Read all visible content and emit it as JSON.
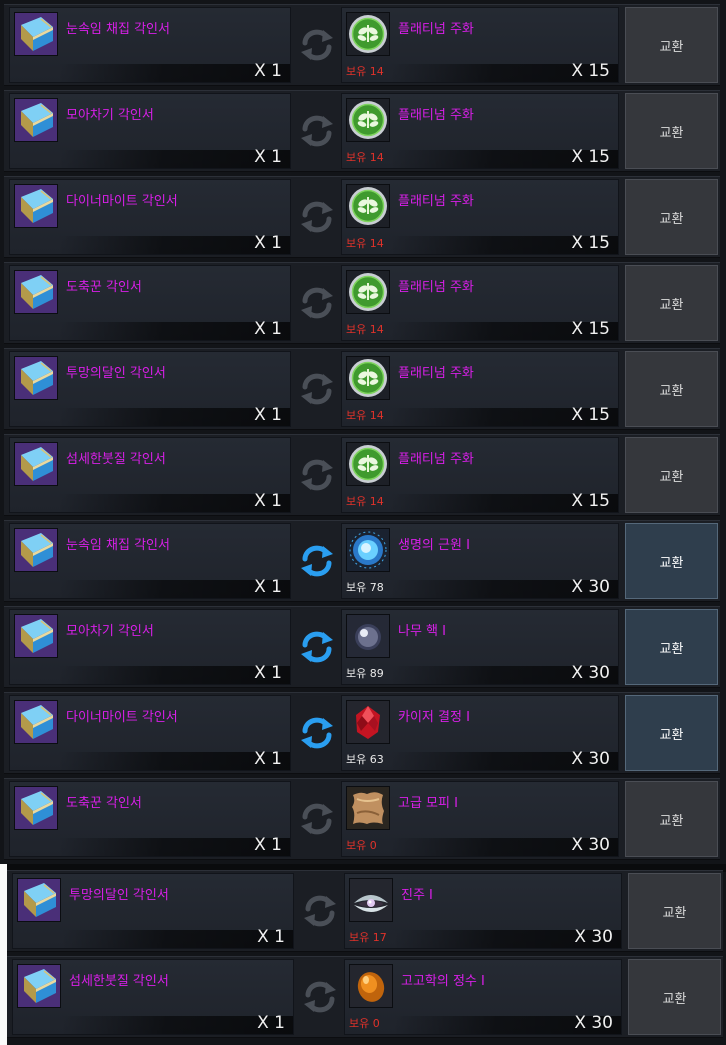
{
  "exchange_list": {
    "rows": [
      {
        "input_name": "눈속임 채집 각인서",
        "input_qty": "X 1",
        "output_name": "플래티넘 주화",
        "output_owned": "보유 14",
        "owned_color": "red",
        "output_qty": "X 15",
        "output_icon": "platinum-coin-icon",
        "button": "교환",
        "button_active": false,
        "swap_active": false
      },
      {
        "input_name": "모아차기 각인서",
        "input_qty": "X 1",
        "output_name": "플래티넘 주화",
        "output_owned": "보유 14",
        "owned_color": "red",
        "output_qty": "X 15",
        "output_icon": "platinum-coin-icon",
        "button": "교환",
        "button_active": false,
        "swap_active": false
      },
      {
        "input_name": "다이너마이트 각인서",
        "input_qty": "X 1",
        "output_name": "플래티넘 주화",
        "output_owned": "보유 14",
        "owned_color": "red",
        "output_qty": "X 15",
        "output_icon": "platinum-coin-icon",
        "button": "교환",
        "button_active": false,
        "swap_active": false
      },
      {
        "input_name": "도축꾼 각인서",
        "input_qty": "X 1",
        "output_name": "플래티넘 주화",
        "output_owned": "보유 14",
        "owned_color": "red",
        "output_qty": "X 15",
        "output_icon": "platinum-coin-icon",
        "button": "교환",
        "button_active": false,
        "swap_active": false
      },
      {
        "input_name": "투망의달인 각인서",
        "input_qty": "X 1",
        "output_name": "플래티넘 주화",
        "output_owned": "보유 14",
        "owned_color": "red",
        "output_qty": "X 15",
        "output_icon": "platinum-coin-icon",
        "button": "교환",
        "button_active": false,
        "swap_active": false
      },
      {
        "input_name": "섬세한붓질 각인서",
        "input_qty": "X 1",
        "output_name": "플래티넘 주화",
        "output_owned": "보유 14",
        "owned_color": "red",
        "output_qty": "X 15",
        "output_icon": "platinum-coin-icon",
        "button": "교환",
        "button_active": false,
        "swap_active": false
      },
      {
        "input_name": "눈속임 채집 각인서",
        "input_qty": "X 1",
        "output_name": "생명의 근원 Ⅰ",
        "output_owned": "보유 78",
        "owned_color": "white",
        "output_qty": "X 30",
        "output_icon": "life-essence-orb-icon",
        "button": "교환",
        "button_active": true,
        "swap_active": true
      },
      {
        "input_name": "모아차기 각인서",
        "input_qty": "X 1",
        "output_name": "나무 핵 Ⅰ",
        "output_owned": "보유 89",
        "owned_color": "white",
        "output_qty": "X 30",
        "output_icon": "wood-core-pearl-icon",
        "button": "교환",
        "button_active": true,
        "swap_active": true
      },
      {
        "input_name": "다이너마이트 각인서",
        "input_qty": "X 1",
        "output_name": "카이저 결정 Ⅰ",
        "output_owned": "보유 63",
        "owned_color": "white",
        "output_qty": "X 30",
        "output_icon": "red-crystal-icon",
        "button": "교환",
        "button_active": true,
        "swap_active": true
      },
      {
        "input_name": "도축꾼 각인서",
        "input_qty": "X 1",
        "output_name": "고급 모피 Ⅰ",
        "output_owned": "보유 0",
        "owned_color": "red",
        "output_qty": "X 30",
        "output_icon": "leather-hide-icon",
        "button": "교환",
        "button_active": false,
        "swap_active": false
      },
      {
        "input_name": "투망의달인 각인서",
        "input_qty": "X 1",
        "output_name": "진주 Ⅰ",
        "output_owned": "보유 17",
        "owned_color": "red",
        "output_qty": "X 30",
        "output_icon": "pearl-shell-icon",
        "button": "교환",
        "button_active": false,
        "swap_active": false
      },
      {
        "input_name": "섬세한붓질 각인서",
        "input_qty": "X 1",
        "output_name": "고고학의 정수 Ⅰ",
        "output_owned": "보유 0",
        "owned_color": "red",
        "output_qty": "X 30",
        "output_icon": "amber-essence-icon",
        "button": "교환",
        "button_active": false,
        "swap_active": false
      }
    ]
  },
  "colors": {
    "item_name": "#d81fe8",
    "owned_insufficient": "#e0322a",
    "owned_sufficient": "#eaeaea",
    "swap_active": "#2a9ef0",
    "swap_inactive": "#4a4f57"
  }
}
